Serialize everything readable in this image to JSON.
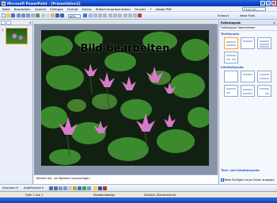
{
  "window": {
    "title": "Microsoft PowerPoint - [Präsentation2]",
    "min": "_",
    "max": "□",
    "close": "×"
  },
  "menu": {
    "items": [
      "Datei",
      "Bearbeiten",
      "Ansicht",
      "Einfügen",
      "Format",
      "Extras",
      "Bildschirmpräsentation",
      "Fenster",
      "?",
      "Adobe PDF"
    ],
    "help_placeholder": "Frage hier eingeben"
  },
  "toolbar": {
    "zoom": "60%",
    "design_label": "Entwurf",
    "new_slide_label": "Neue Folie"
  },
  "left_pane": {
    "close": "×",
    "slide_number": "1"
  },
  "slide": {
    "title": "Bild bearbeiten"
  },
  "notes": {
    "placeholder": "Klicken Sie, um Notizen hinzuzufügen"
  },
  "task_pane": {
    "title": "Folienlayout",
    "close": "×",
    "subtitle": "Folienlayout übernehmen:",
    "sections": [
      "Textlayouts",
      "Inhaltslayouts",
      "Text- und Inhaltslayouts"
    ],
    "show_on_insert": "Beim Einfügen neuer Folien anzeigen",
    "checkbox": "✓"
  },
  "drawbar": {
    "draw_label": "Zeichnen ▾",
    "autoshapes_label": "AutoFormen ▾"
  },
  "status": {
    "slide": "Folie 1 von 1",
    "design": "Standarddesign",
    "language": "Deutsch (Deutschland)"
  },
  "colors": {
    "xp_blue": "#0A46C4",
    "selection_orange": "#F7A22C",
    "lily_pink": "#D67BC8",
    "leaf_green": "#3C8A2E"
  }
}
